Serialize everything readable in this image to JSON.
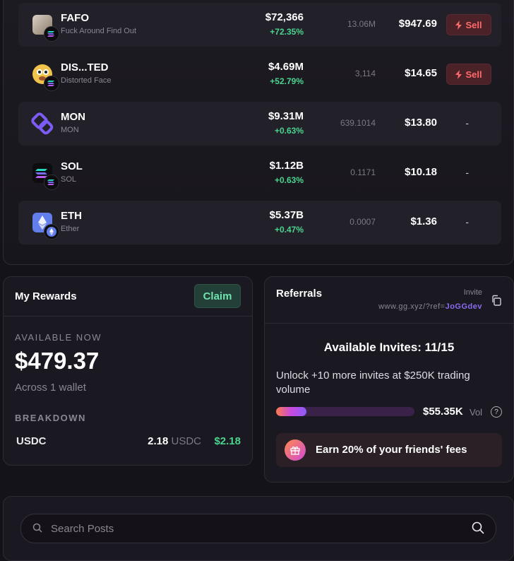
{
  "holdings": [
    {
      "symbol": "FAFO",
      "name": "Fuck Around Find Out",
      "mcap": "$72,366",
      "change": "+72.35%",
      "amount": "13.06M",
      "value": "$947.69",
      "action": "Sell",
      "icon": "fafo-token-icon",
      "chain": "solana-icon",
      "shaded": true
    },
    {
      "symbol": "DIS...TED",
      "name": "Distorted Face",
      "mcap": "$4.69M",
      "change": "+52.79%",
      "amount": "3,114",
      "value": "$14.65",
      "action": "Sell",
      "icon": "distorted-face-token-icon",
      "chain": "solana-icon",
      "shaded": false
    },
    {
      "symbol": "MON",
      "name": "MON",
      "mcap": "$9.31M",
      "change": "+0.63%",
      "amount": "639.1014",
      "value": "$13.80",
      "action": "-",
      "icon": "mon-token-icon",
      "chain": "",
      "shaded": true
    },
    {
      "symbol": "SOL",
      "name": "SOL",
      "mcap": "$1.12B",
      "change": "+0.63%",
      "amount": "0.1171",
      "value": "$10.18",
      "action": "-",
      "icon": "sol-token-icon",
      "chain": "solana-icon",
      "shaded": false
    },
    {
      "symbol": "ETH",
      "name": "Ether",
      "mcap": "$5.37B",
      "change": "+0.47%",
      "amount": "0.0007",
      "value": "$1.36",
      "action": "-",
      "icon": "eth-token-icon",
      "chain": "ethereum-icon",
      "shaded": true
    }
  ],
  "rewards": {
    "title": "My Rewards",
    "claim_label": "Claim",
    "available_label": "AVAILABLE NOW",
    "available_amount": "$479.37",
    "available_sub": "Across 1 wallet",
    "breakdown_label": "BREAKDOWN",
    "breakdown": {
      "token": "USDC",
      "amount": "2.18",
      "unit": "USDC",
      "usd": "$2.18"
    }
  },
  "referrals": {
    "title": "Referrals",
    "invite_label": "Invite",
    "invite_link_prefix": "www.gg.xyz/?ref=",
    "invite_code": "JoGGdev",
    "available_invites": "Available Invites: 11/15",
    "unlock_text": "Unlock +10 more invites at $250K trading volume",
    "progress_fraction": 0.22,
    "volume": "$55.35K",
    "volume_unit": "Vol",
    "earn_text": "Earn 20% of your friends' fees"
  },
  "search": {
    "placeholder": "Search Posts"
  },
  "colors": {
    "positive": "#4ad48e",
    "sell": "#ff6a6a",
    "link": "#8b6cf0",
    "claim": "#6fe3b0"
  }
}
